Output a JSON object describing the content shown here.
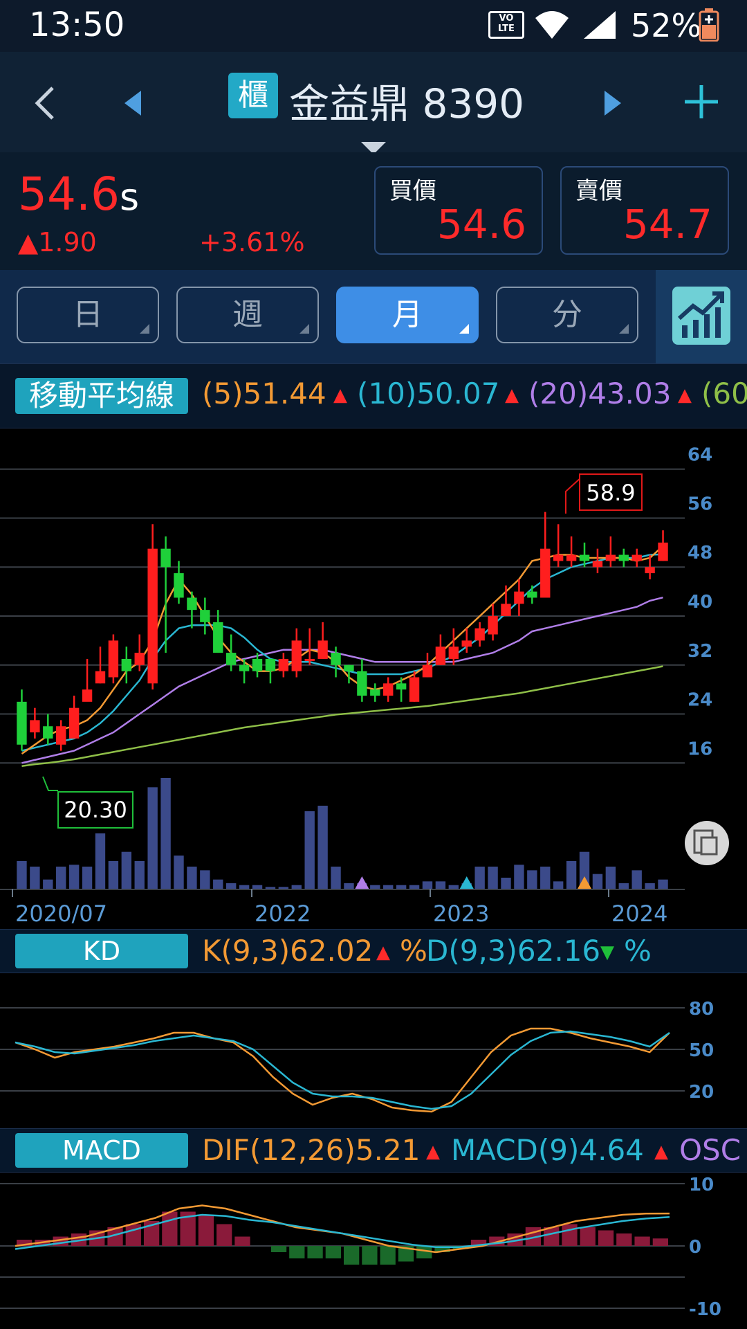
{
  "status_bar": {
    "time": "13:50",
    "network": "VoLTE",
    "battery": "52%"
  },
  "header": {
    "back_icon": "chevron-left-icon",
    "market_tag": "櫃",
    "stock_name": "金益鼎",
    "stock_code": "8390"
  },
  "quote": {
    "price": "54.6",
    "price_suffix": "s",
    "change": "1.90",
    "change_pct": "+3.61%",
    "bid_label": "買價",
    "bid": "54.6",
    "ask_label": "賣價",
    "ask": "54.7",
    "up_color": "#ff2a2a"
  },
  "period_tabs": [
    {
      "label": "日",
      "active": false
    },
    {
      "label": "週",
      "active": false
    },
    {
      "label": "月",
      "active": true
    },
    {
      "label": "分",
      "active": false
    }
  ],
  "ma_legend": {
    "title": "移動平均線",
    "items": [
      {
        "label": "(5)51.44",
        "color": "#f39a34"
      },
      {
        "label": "(10)50.07",
        "color": "#2ab7d2"
      },
      {
        "label": "(20)43.03",
        "color": "#b07ee8"
      },
      {
        "label": "(60",
        "color": "#8fbf48"
      }
    ]
  },
  "price_chart": {
    "y_ticks": [
      "64",
      "56",
      "48",
      "40",
      "32",
      "24",
      "16"
    ],
    "x_labels": [
      "2020/07",
      "2022",
      "2023",
      "2024"
    ],
    "high_marker": "58.9",
    "low_marker": "20.30"
  },
  "kd": {
    "title": "KD",
    "k_label": "K(9,3)62.02",
    "d_label": "D(9,3)62.16",
    "unit": "%",
    "y_ticks": [
      "80",
      "50",
      "20"
    ]
  },
  "macd": {
    "title": "MACD",
    "dif_label": "DIF(12,26)5.21",
    "macd_label": "MACD(9)4.64",
    "osc_label": "OSC",
    "y_ticks": [
      "10",
      "0",
      "-10"
    ]
  },
  "chart_data": [
    {
      "type": "candlestick",
      "title": "",
      "ylim": [
        14,
        66
      ],
      "candles": [
        [
          26,
          19,
          28,
          18
        ],
        [
          21,
          23,
          25,
          20
        ],
        [
          22,
          20,
          24,
          19
        ],
        [
          19,
          22,
          23,
          18
        ],
        [
          20,
          25,
          27,
          20
        ],
        [
          26,
          28,
          33,
          27
        ],
        [
          29,
          31,
          35,
          29
        ],
        [
          30,
          36,
          37,
          29
        ],
        [
          33,
          31,
          35,
          29
        ],
        [
          32,
          34,
          37,
          31
        ],
        [
          29,
          51,
          55,
          28
        ],
        [
          51,
          48,
          53,
          34
        ],
        [
          47,
          43,
          49,
          42
        ],
        [
          43,
          41,
          44,
          38
        ],
        [
          41,
          39,
          43,
          37
        ],
        [
          39,
          34,
          41,
          34
        ],
        [
          34,
          32,
          37,
          31
        ],
        [
          32,
          31,
          33,
          29
        ],
        [
          33,
          31,
          34,
          30
        ],
        [
          33,
          31,
          33,
          29
        ],
        [
          31,
          33,
          34,
          30
        ],
        [
          31,
          36,
          38,
          30
        ],
        [
          33,
          33,
          38,
          32
        ],
        [
          33,
          36,
          39,
          33
        ],
        [
          34,
          32,
          35,
          30
        ],
        [
          32,
          31,
          32,
          29
        ],
        [
          31,
          27,
          33,
          26
        ],
        [
          28,
          27,
          29,
          26
        ],
        [
          27,
          29,
          30,
          26
        ],
        [
          29,
          28,
          30,
          26
        ],
        [
          26,
          30,
          31,
          26
        ],
        [
          30,
          32,
          34,
          30
        ],
        [
          32,
          35,
          37,
          32
        ],
        [
          33,
          35,
          38,
          32
        ],
        [
          35,
          36,
          38,
          34
        ],
        [
          36,
          38,
          39,
          35
        ],
        [
          37,
          40,
          42,
          36
        ],
        [
          40,
          42,
          45,
          40
        ],
        [
          42,
          44,
          46,
          40
        ],
        [
          44,
          43,
          45,
          42
        ],
        [
          43,
          51,
          57,
          44
        ],
        [
          49,
          50,
          55,
          48
        ],
        [
          49,
          50,
          53,
          48
        ],
        [
          50,
          49,
          52,
          48
        ],
        [
          48,
          49,
          51,
          47
        ],
        [
          49,
          50,
          53,
          48
        ],
        [
          50,
          49,
          51,
          48
        ],
        [
          49,
          50,
          51,
          48
        ],
        [
          47,
          48,
          50,
          46
        ],
        [
          49,
          52,
          54,
          49
        ]
      ],
      "volume": [
        15,
        12,
        5,
        12,
        13,
        12,
        30,
        15,
        20,
        15,
        55,
        60,
        18,
        12,
        10,
        5,
        3,
        2,
        2,
        1,
        1,
        2,
        42,
        45,
        12,
        3,
        3,
        2,
        2,
        2,
        2,
        4,
        4,
        2,
        3,
        12,
        12,
        6,
        13,
        10,
        12,
        4,
        15,
        20,
        8,
        12,
        3,
        10,
        3,
        5
      ],
      "ma5": [
        17.5,
        19,
        20.5,
        21.5,
        22,
        23,
        25,
        28,
        31,
        32.5,
        36,
        42,
        46,
        43.5,
        40,
        36.5,
        34,
        32.5,
        31,
        31,
        31.5,
        33,
        34.5,
        34,
        32.5,
        30,
        28.5,
        28,
        28.5,
        29.5,
        30.5,
        32,
        34,
        36,
        38,
        40,
        42,
        44,
        46,
        49,
        49.5,
        50,
        50,
        49.5,
        49.5,
        49.5,
        49.5,
        49,
        49.5,
        51.44
      ],
      "ma10": [
        18,
        18.5,
        19,
        19.5,
        20,
        21,
        22.5,
        24.5,
        27,
        29.5,
        33,
        36,
        38,
        38.5,
        38.5,
        38.5,
        38,
        36.5,
        34.5,
        33,
        32.5,
        32.5,
        32.5,
        32,
        31.5,
        31,
        30.5,
        30.5,
        30.5,
        30.5,
        31,
        31.5,
        32.5,
        33.5,
        35,
        36.5,
        38.5,
        40.5,
        42.5,
        44.5,
        46,
        47,
        48,
        48.5,
        49,
        49.5,
        49.5,
        49.5,
        50,
        50.07
      ],
      "ma20": [
        16,
        16.5,
        17,
        17.5,
        18,
        19,
        20,
        21,
        22.5,
        24,
        25.5,
        27,
        28.5,
        29.5,
        30.5,
        31.5,
        32.5,
        33,
        33.5,
        34,
        34.5,
        34.5,
        34.5,
        34.5,
        34,
        33.5,
        33,
        32.5,
        32.5,
        32.5,
        32.5,
        32.5,
        32.5,
        32.5,
        33,
        33.5,
        34,
        35,
        36,
        37.5,
        38,
        38.5,
        39,
        39.5,
        40,
        40.5,
        41,
        41.5,
        42.5,
        43.03
      ],
      "ma60": [
        15.5,
        15.8,
        16,
        16.3,
        16.6,
        17,
        17.4,
        17.8,
        18.2,
        18.6,
        19,
        19.4,
        19.8,
        20.2,
        20.6,
        21,
        21.4,
        21.8,
        22.1,
        22.4,
        22.7,
        23,
        23.3,
        23.6,
        23.9,
        24.1,
        24.3,
        24.5,
        24.7,
        24.9,
        25.1,
        25.3,
        25.6,
        25.9,
        26.2,
        26.5,
        26.8,
        27.1,
        27.4,
        27.8,
        28.2,
        28.6,
        29,
        29.4,
        29.8,
        30.2,
        30.6,
        31,
        31.4,
        31.8
      ]
    },
    {
      "type": "line",
      "title": "KD",
      "ylim": [
        0,
        100
      ],
      "series": [
        {
          "name": "K(9,3)",
          "values": [
            55,
            50,
            44,
            48,
            50,
            52,
            55,
            58,
            62,
            62,
            58,
            55,
            45,
            30,
            18,
            10,
            15,
            18,
            14,
            8,
            6,
            5,
            12,
            30,
            48,
            60,
            65,
            65,
            62,
            58,
            55,
            52,
            48,
            62
          ]
        },
        {
          "name": "D(9,3)",
          "values": [
            55,
            52,
            48,
            47,
            49,
            51,
            53,
            56,
            58,
            60,
            58,
            56,
            50,
            38,
            26,
            18,
            16,
            16,
            15,
            12,
            9,
            7,
            9,
            18,
            32,
            46,
            56,
            62,
            63,
            61,
            59,
            56,
            52,
            62
          ]
        }
      ]
    },
    {
      "type": "line",
      "title": "MACD",
      "ylim": [
        -10,
        10
      ],
      "series": [
        {
          "name": "DIF(12,26)",
          "values": [
            0,
            0.5,
            1,
            1.5,
            2.5,
            3.5,
            4.5,
            6,
            6.5,
            6,
            5,
            4,
            3,
            2.5,
            2,
            1,
            0,
            -0.5,
            -1,
            -0.5,
            0,
            1,
            2,
            3,
            4,
            4.5,
            5,
            5.2,
            5.21
          ]
        },
        {
          "name": "MACD(9)",
          "values": [
            -0.5,
            0,
            0.5,
            1,
            1.5,
            2.5,
            3.5,
            4.5,
            5,
            4.8,
            4.2,
            3.8,
            3.2,
            2.6,
            2,
            1.4,
            0.8,
            0.2,
            -0.2,
            -0.2,
            0.2,
            0.6,
            1.2,
            2,
            2.8,
            3.4,
            4,
            4.4,
            4.64
          ]
        },
        {
          "name": "OSC",
          "values": [
            1,
            1,
            1.5,
            2,
            2.5,
            3,
            3.5,
            4,
            5.5,
            5.5,
            5,
            3.5,
            1.5,
            0,
            -1,
            -2,
            -2,
            -2,
            -3,
            -3,
            -3,
            -2.5,
            -2,
            -1,
            -0.5,
            1,
            1.5,
            2,
            3,
            3,
            3.5,
            3,
            2.5,
            2,
            1.5,
            1.2
          ]
        }
      ]
    }
  ]
}
